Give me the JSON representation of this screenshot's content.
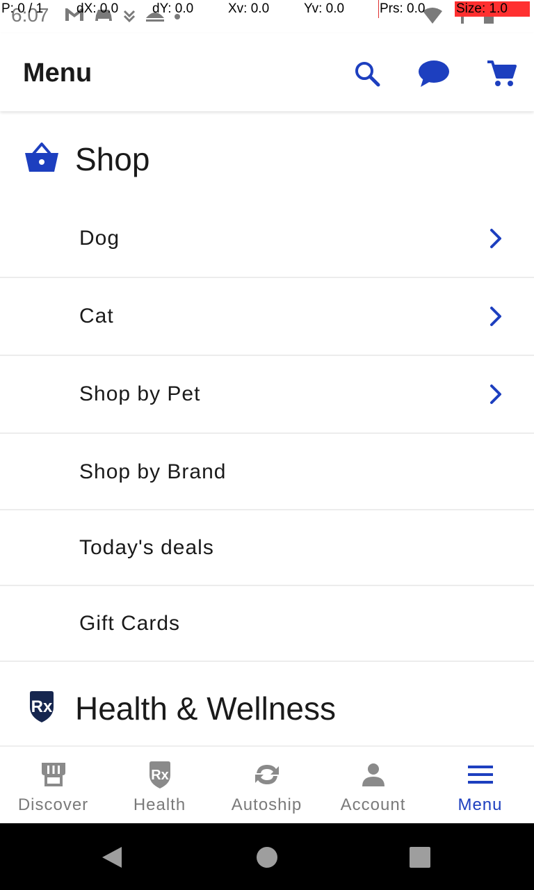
{
  "status_bar": {
    "time": "6:07",
    "debug": {
      "pointer": "P: 0 / 1",
      "dx": "dX: 0.0",
      "dy": "dY: 0.0",
      "xv": "Xv: 0.0",
      "yv": "Yv: 0.0",
      "prs": "Prs: 0.0",
      "size": "Size: 1.0"
    }
  },
  "app_bar": {
    "title": "Menu",
    "icons": [
      "search-icon",
      "chat-icon",
      "cart-icon"
    ],
    "accent_color": "#1d3fbf"
  },
  "sections": [
    {
      "title": "Shop",
      "icon": "basket-icon",
      "items": [
        {
          "label": "Dog",
          "has_chevron": true
        },
        {
          "label": "Cat",
          "has_chevron": true
        },
        {
          "label": "Shop by Pet",
          "has_chevron": true
        },
        {
          "label": "Shop by Brand",
          "has_chevron": false
        },
        {
          "label": "Today's deals",
          "has_chevron": false
        },
        {
          "label": "Gift Cards",
          "has_chevron": false
        }
      ]
    },
    {
      "title": "Health & Wellness",
      "icon": "rx-shield-icon",
      "items": []
    }
  ],
  "bottom_nav": {
    "items": [
      {
        "label": "Discover",
        "icon": "storefront-icon",
        "active": false
      },
      {
        "label": "Health",
        "icon": "rx-shield-icon",
        "active": false
      },
      {
        "label": "Autoship",
        "icon": "autoship-icon",
        "active": false
      },
      {
        "label": "Account",
        "icon": "person-icon",
        "active": false
      },
      {
        "label": "Menu",
        "icon": "hamburger-icon",
        "active": true
      }
    ]
  },
  "system_nav": {
    "buttons": [
      "back-icon",
      "home-icon",
      "recents-icon"
    ]
  }
}
